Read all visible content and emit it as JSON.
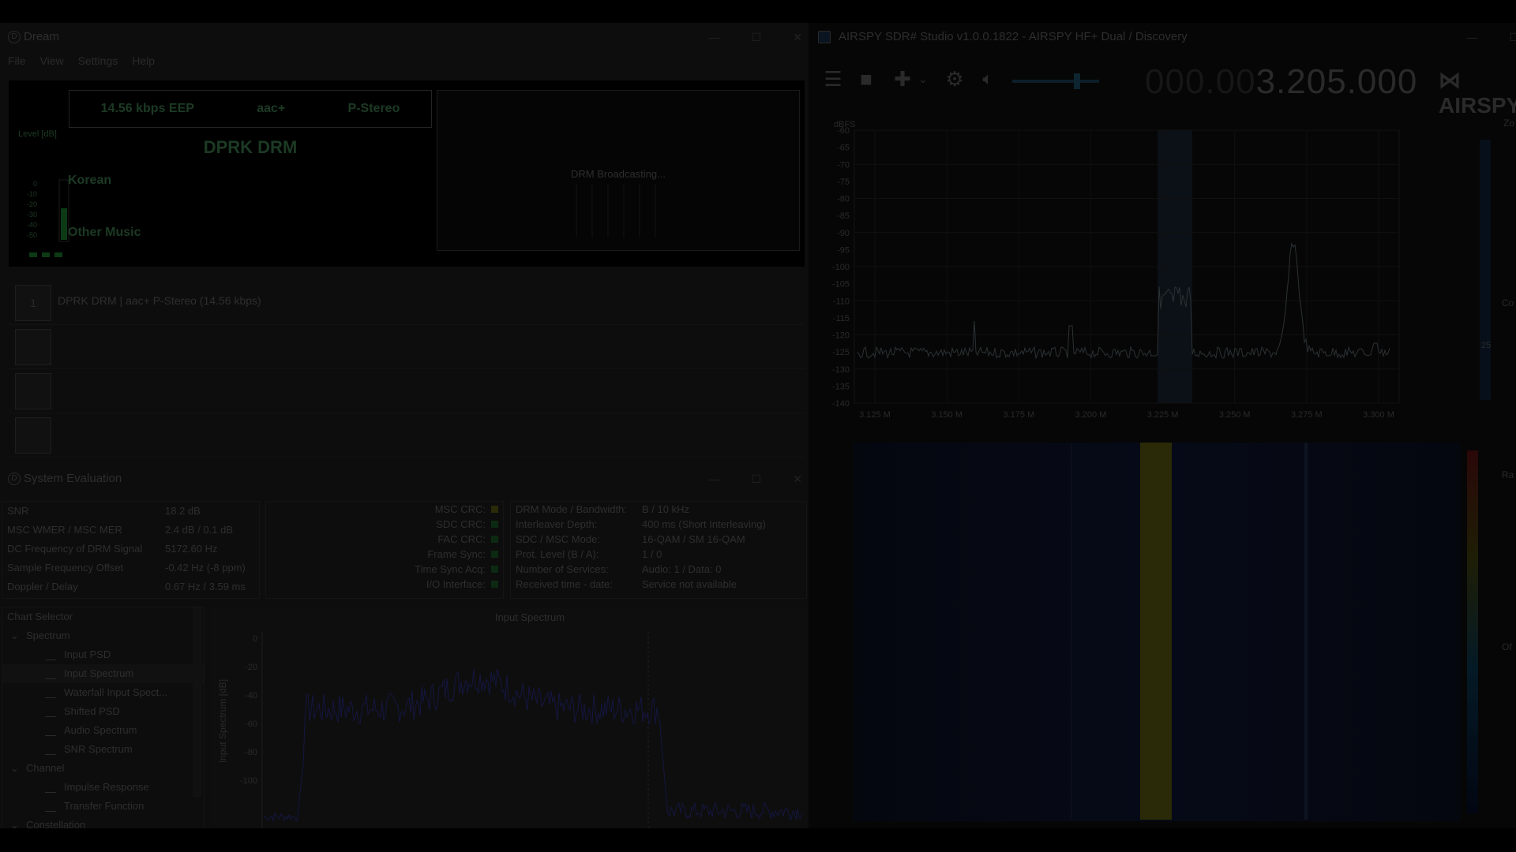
{
  "dream": {
    "title": "Dream",
    "menu": [
      "File",
      "View",
      "Settings",
      "Help"
    ],
    "service_info": {
      "bitrate": "14.56 kbps EEP",
      "codec": "aac+",
      "stereo": "P-Stereo"
    },
    "station": "DPRK DRM",
    "level_label": "Level [dB]",
    "meter_ticks": [
      "0",
      "-10",
      "-20",
      "-30",
      "-40",
      "-50"
    ],
    "language": "Korean",
    "program_type": "Other Music",
    "slideshow_text": "DRM Broadcasting...",
    "services": [
      {
        "number": "1",
        "label": "DPRK DRM  |  aac+ P-Stereo (14.56 kbps)"
      },
      {
        "number": "",
        "label": ""
      },
      {
        "number": "",
        "label": ""
      },
      {
        "number": "",
        "label": ""
      }
    ]
  },
  "evaluation": {
    "title": "System Evaluation",
    "params": [
      {
        "key": "SNR",
        "value": "18.2 dB"
      },
      {
        "key": "MSC WMER / MSC MER",
        "value": "2.4 dB / 0.1 dB"
      },
      {
        "key": "DC Frequency of DRM Signal",
        "value": "5172.60 Hz"
      },
      {
        "key": "Sample Frequency Offset",
        "value": "-0.42 Hz (-8 ppm)"
      },
      {
        "key": "Doppler / Delay",
        "value": "0.67 Hz / 3.59 ms"
      }
    ],
    "crc": [
      {
        "label": "MSC CRC:",
        "color": "#2a2a08"
      },
      {
        "label": "SDC CRC:",
        "color": "#0c2a12"
      },
      {
        "label": "FAC CRC:",
        "color": "#0c2a12"
      },
      {
        "label": "Frame Sync:",
        "color": "#0c2a12"
      },
      {
        "label": "Time Sync Acq:",
        "color": "#0c2a12"
      },
      {
        "label": "I/O Interface:",
        "color": "#0c2a12"
      }
    ],
    "mode": [
      {
        "key": "DRM Mode / Bandwidth:",
        "value": "B / 10 kHz"
      },
      {
        "key": "Interleaver Depth:",
        "value": "400 ms (Short Interleaving)"
      },
      {
        "key": "SDC / MSC Mode:",
        "value": "16-QAM / SM 16-QAM"
      },
      {
        "key": "Prot. Level (B / A):",
        "value": "1 / 0"
      },
      {
        "key": "Number of Services:",
        "value": "Audio: 1 / Data: 0"
      },
      {
        "key": "Received time - date:",
        "value": "Service not available"
      }
    ],
    "chart_selector": {
      "title": "Chart Selector",
      "groups": [
        {
          "name": "Spectrum",
          "items": [
            "Input PSD",
            "Input Spectrum",
            "Waterfall Input Spect...",
            "Shifted PSD",
            "Audio Spectrum",
            "SNR Spectrum"
          ]
        },
        {
          "name": "Channel",
          "items": [
            "Impulse Response",
            "Transfer Function"
          ]
        },
        {
          "name": "Constellation",
          "items": []
        }
      ]
    },
    "plot": {
      "title": "Input Spectrum",
      "ylabel": "Input Spectrum [dB]",
      "yticks": [
        "0",
        "-20",
        "-40",
        "-60",
        "-80",
        "-100"
      ]
    }
  },
  "sdr": {
    "title": "AIRSPY SDR# Studio v1.0.0.1822 - AIRSPY HF+ Dual / Discovery",
    "freq_dim": "000.00",
    "freq_main": "3.205.000",
    "brand": "AIRSPY",
    "dbfs_label": "dBFS",
    "yticks": [
      "-60",
      "-65",
      "-70",
      "-75",
      "-80",
      "-85",
      "-90",
      "-95",
      "-100",
      "-105",
      "-110",
      "-115",
      "-120",
      "-125",
      "-130",
      "-135",
      "-140"
    ],
    "xticks": [
      "3.125 M",
      "3.150 M",
      "3.175 M",
      "3.200 M",
      "3.225 M",
      "3.250 M",
      "3.275 M",
      "3.300 M"
    ],
    "side_labels": [
      "Zo",
      "Co",
      "Ra",
      "Of"
    ],
    "right_value": "25"
  }
}
